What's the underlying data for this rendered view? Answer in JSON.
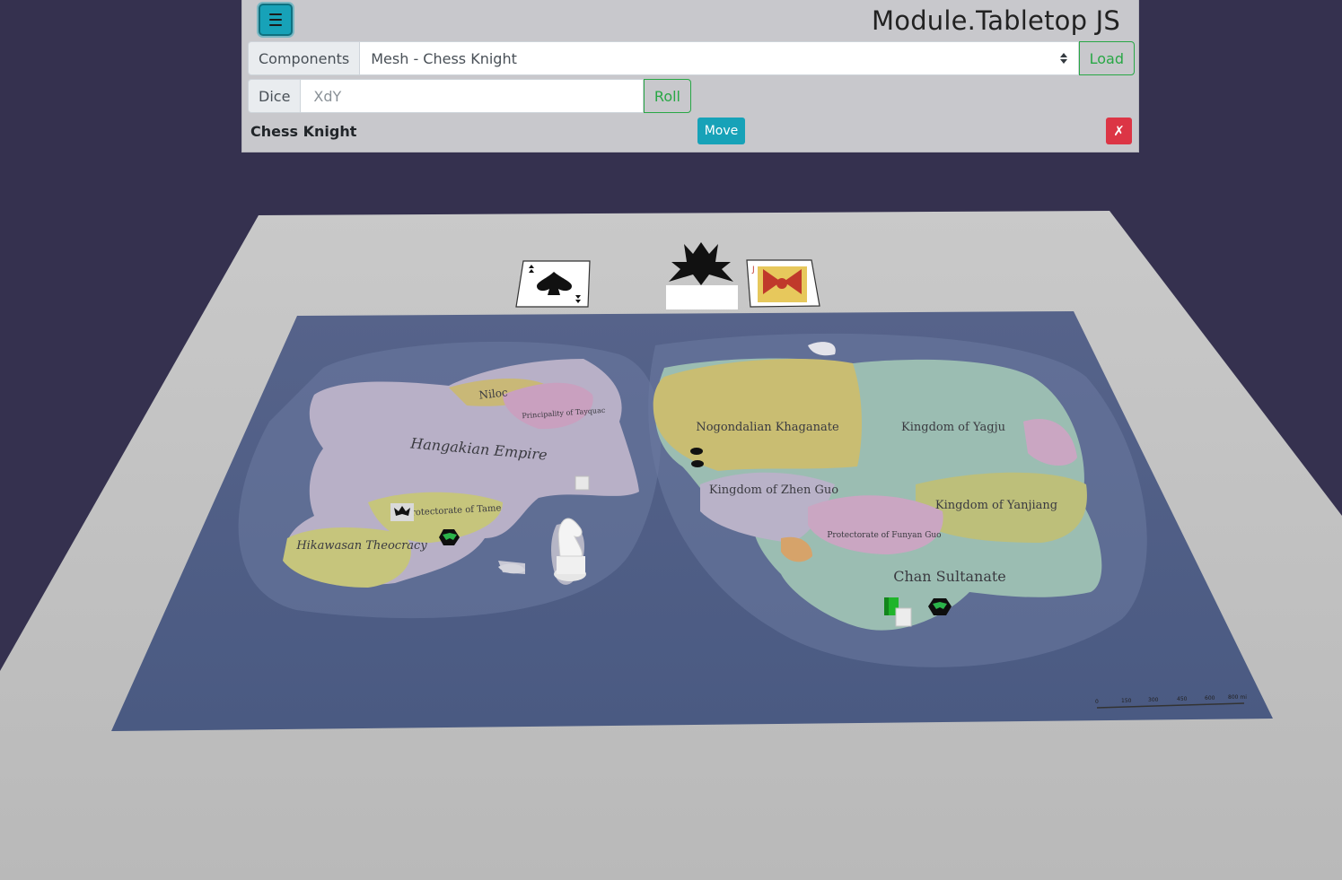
{
  "app": {
    "title": "Module.Tabletop JS"
  },
  "toolbar": {
    "menu_icon": "hamburger-menu-icon",
    "components_label": "Components",
    "component_selected": "Mesh - Chess Knight",
    "load_label": "Load",
    "dice_label": "Dice",
    "dice_placeholder": "XdY",
    "roll_label": "Roll"
  },
  "selection": {
    "name": "Chess Knight",
    "move_label": "Move",
    "remove_label": "✗"
  },
  "map": {
    "regions": [
      "Niloc",
      "Principality of Tayquac",
      "Hangakian Empire",
      "Protectorate of Tame",
      "Hikawasan Theocracy",
      "Nogondalian Khaganate",
      "Kingdom of Yagju",
      "Kingdom of Zhen Guo",
      "Kingdom of Yanjiang",
      "Protectorate of Funyan Guo",
      "Chan Sultanate"
    ],
    "scale_labels": [
      "0",
      "150",
      "300",
      "450",
      "600",
      "800 mi"
    ]
  },
  "colors": {
    "background": "#35314f",
    "table": "#c2c2c2",
    "ocean": "#4f5e84",
    "accent": "#17a2b8",
    "success": "#28a745",
    "danger": "#dc3545"
  }
}
